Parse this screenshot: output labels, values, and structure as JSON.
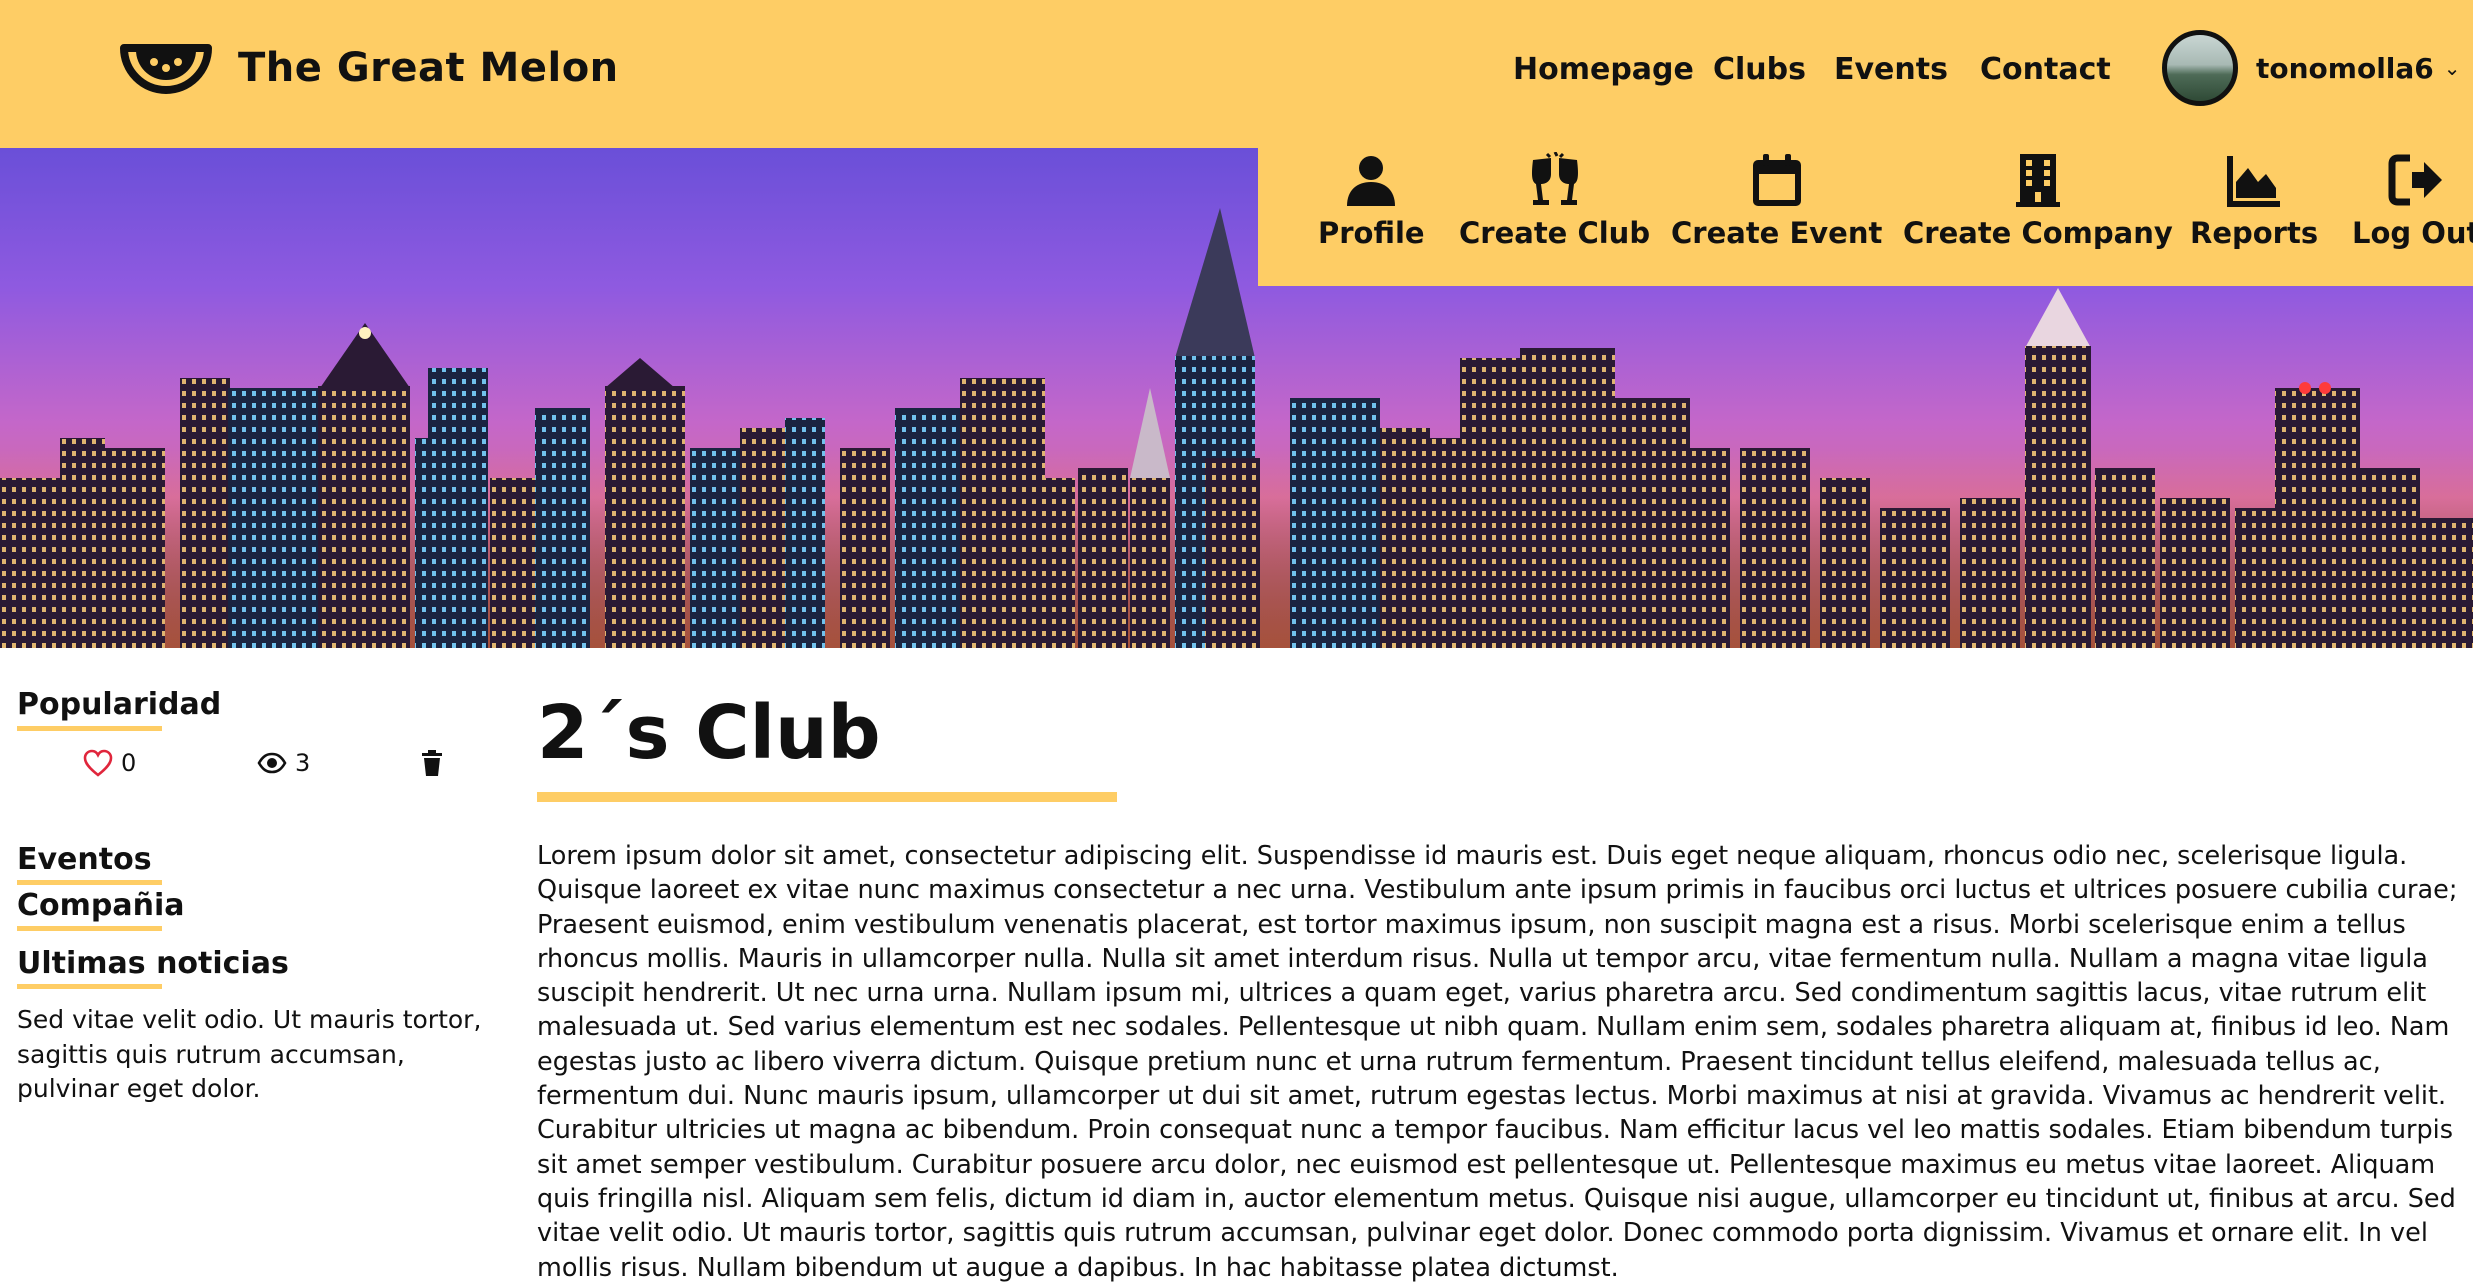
{
  "header": {
    "brand": "The Great Melon",
    "nav": [
      "Homepage",
      "Clubs",
      "Events",
      "Contact"
    ],
    "user": {
      "name": "tonomolla6"
    }
  },
  "user_menu": {
    "items": [
      {
        "label": "Profile",
        "icon": "user-icon"
      },
      {
        "label": "Create Club",
        "icon": "glasses-cheers-icon"
      },
      {
        "label": "Create Event",
        "icon": "calendar-icon"
      },
      {
        "label": "Create Company",
        "icon": "building-icon"
      },
      {
        "label": "Reports",
        "icon": "area-chart-icon"
      },
      {
        "label": "Log Out",
        "icon": "sign-out-icon"
      }
    ]
  },
  "sidebar": {
    "popularity_title": "Popularidad",
    "likes": "0",
    "views": "3",
    "events_link": "Eventos",
    "company_link": "Compañia",
    "news_title": "Ultimas noticias",
    "news_text": "Sed vitae velit odio. Ut mauris tortor, sagittis quis rutrum accumsan, pulvinar eget dolor."
  },
  "club": {
    "title": "2´s Club",
    "description": "Lorem ipsum dolor sit amet, consectetur adipiscing elit. Suspendisse id mauris est. Duis eget neque aliquam, rhoncus odio nec, scelerisque ligula. Quisque laoreet ex vitae nunc maximus consectetur a nec urna. Vestibulum ante ipsum primis in faucibus orci luctus et ultrices posuere cubilia curae; Praesent euismod, enim vestibulum venenatis placerat, est tortor maximus ipsum, non suscipit magna est a risus. Morbi scelerisque enim a tellus rhoncus mollis. Mauris in ullamcorper nulla. Nulla sit amet interdum risus. Nulla ut tempor arcu, vitae fermentum nulla. Nullam a magna vitae ligula suscipit hendrerit. Ut nec urna urna. Nullam ipsum mi, ultrices a quam eget, varius pharetra arcu. Sed condimentum sagittis lacus, vitae rutrum elit malesuada ut. Sed varius elementum est nec sodales. Pellentesque ut nibh quam. Nullam enim sem, sodales pharetra aliquam at, finibus id leo. Nam egestas justo ac libero viverra dictum. Quisque pretium nunc et urna rutrum fermentum. Praesent tincidunt tellus eleifend, malesuada tellus ac, fermentum dui. Nunc mauris ipsum, ullamcorper ut dui sit amet, rutrum egestas lectus. Morbi maximus at nisi at gravida. Vivamus ac hendrerit velit. Curabitur ultricies ut magna ac bibendum. Proin consequat nunc a tempor faucibus. Nam efficitur lacus vel leo mattis sodales. Etiam bibendum turpis sit amet semper vestibulum. Curabitur posuere arcu dolor, nec euismod est pellentesque ut. Pellentesque maximus eu metus vitae laoreet. Aliquam quis fringilla nisl. Aliquam sem felis, dictum id diam in, auctor elementum metus. Quisque nisi augue, ullamcorper eu tincidunt ut, finibus at arcu. Sed vitae velit odio. Ut mauris tortor, sagittis quis rutrum accumsan, pulvinar eget dolor. Donec commodo porta dignissim. Vivamus et ornare elit. In vel mollis risus. Nullam bibendum ut augue a dapibus. In hac habitasse platea dictumst."
  },
  "colors": {
    "accent": "#fecd65",
    "text": "#111111",
    "like": "#e0263c"
  }
}
